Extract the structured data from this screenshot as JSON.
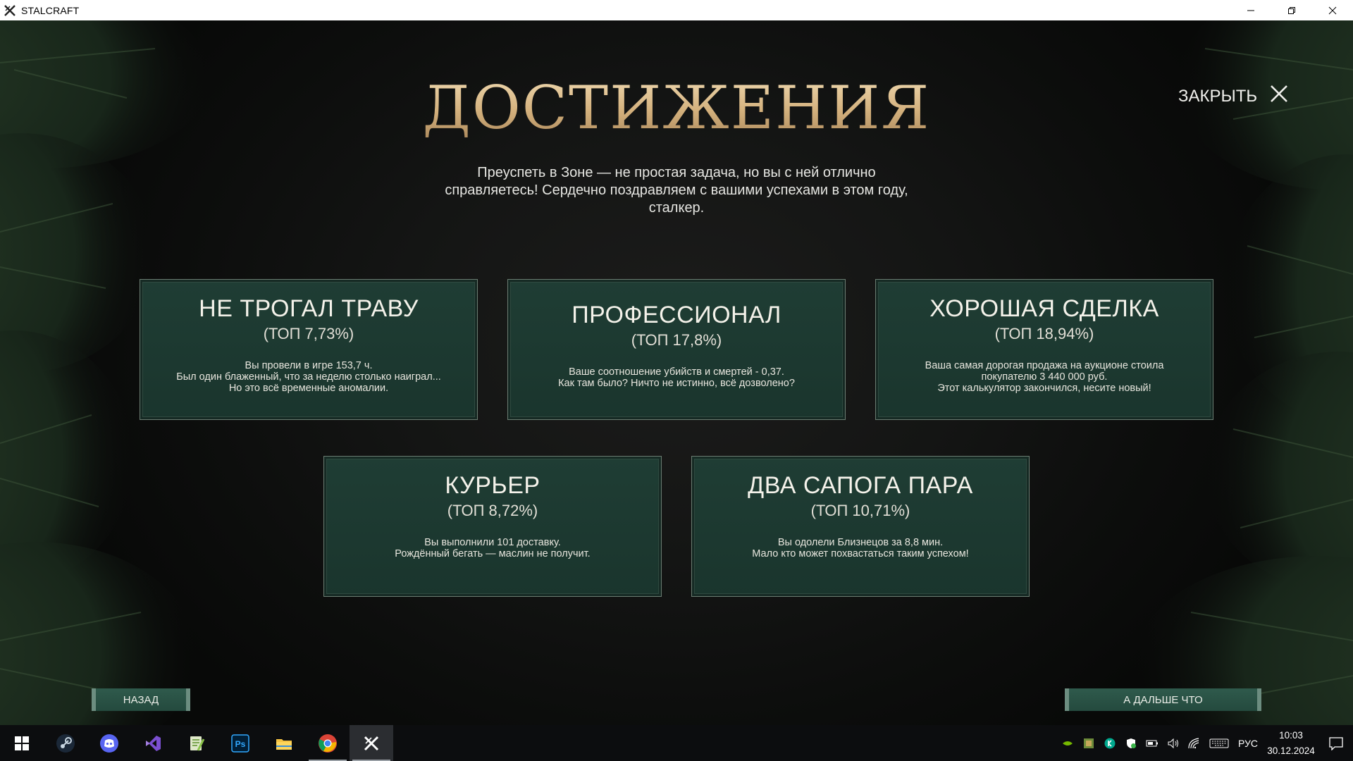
{
  "window": {
    "title": "STALCRAFT",
    "controls": [
      "minimize-icon",
      "restore-icon",
      "close-icon"
    ]
  },
  "screen": {
    "heading": "ДОСТИЖЕНИЯ",
    "subtitle": "Преуспеть в Зоне — не простая задача, но вы с ней отлично справляетесь! Сердечно поздравляем с вашими успехами в этом году, сталкер.",
    "close_label": "ЗАКРЫТЬ"
  },
  "achievements": [
    {
      "name": "НЕ ТРОГАЛ ТРАВУ",
      "rank": "(ТОП 7,73%)",
      "description": "Вы провели в игре 153,7 ч.\nБыл один блаженный, что за неделю столько наиграл...\nНо это всё временные аномалии."
    },
    {
      "name": "ПРОФЕССИОНАЛ",
      "rank": "(ТОП 17,8%)",
      "description": "Ваше соотношение убийств и смертей - 0,37.\nКак там было? Ничто не истинно, всё дозволено?"
    },
    {
      "name": "ХОРОШАЯ СДЕЛКА",
      "rank": "(ТОП 18,94%)",
      "description": "Ваша самая дорогая продажа на аукционе стоила\nпокупателю 3 440 000 руб.\nЭтот калькулятор закончился, несите новый!"
    },
    {
      "name": "КУРЬЕР",
      "rank": "(ТОП 8,72%)",
      "description": "Вы выполнили 101 доставку.\nРождённый бегать — маслин не получит."
    },
    {
      "name": "ДВА САПОГА ПАРА",
      "rank": "(ТОП 10,71%)",
      "description": "Вы одолели Близнецов за 8,8 мин.\nМало кто может похвастаться таким успехом!"
    }
  ],
  "navigation": {
    "back_label": "НАЗАД",
    "next_label": "А ДАЛЬШЕ ЧТО"
  },
  "taskbar": {
    "apps": [
      "windows-start-icon",
      "steam-icon",
      "discord-icon",
      "visual-studio-icon",
      "notepad-plus-plus-icon",
      "photoshop-icon",
      "file-explorer-icon",
      "chrome-icon",
      "stalcraft-icon"
    ],
    "photoshop_text": "Ps",
    "language": "РУС",
    "time": "10:03",
    "date": "30.12.2024"
  },
  "colors": {
    "card_bg": "#1d3a31",
    "heading_gold": "#d3b07c",
    "button_bg": "#2a5245"
  }
}
